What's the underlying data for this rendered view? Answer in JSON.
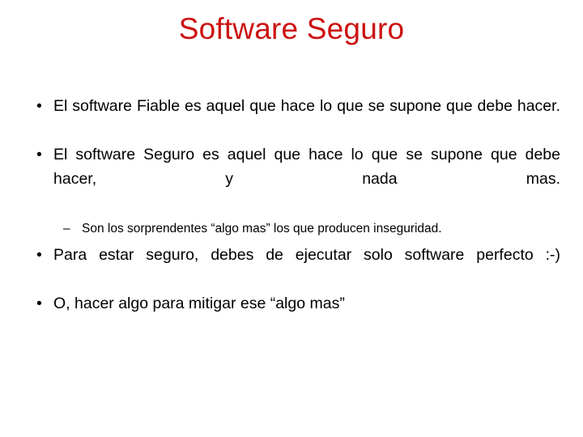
{
  "slide": {
    "title": "Software Seguro",
    "title_color": "#cc1111",
    "background_color": "#ffffff",
    "text_color": "#000000",
    "bullet_marker": "•",
    "dash_marker": "–",
    "content": [
      {
        "level": 1,
        "marker": "•",
        "text": "El software Fiable es aquel que hace lo que se supone que debe hacer."
      },
      {
        "level": 1,
        "marker": "•",
        "text": "El software Seguro es aquel que hace lo que se supone que debe hacer, y nada mas."
      },
      {
        "level": 2,
        "marker": "–",
        "text": "Son los sorprendentes “algo mas” los que producen inseguridad."
      },
      {
        "level": 1,
        "marker": "•",
        "text": "Para estar seguro, debes de ejecutar solo software perfecto :-)"
      },
      {
        "level": 1,
        "marker": "•",
        "text": "O, hacer algo para mitigar ese “algo mas”"
      }
    ]
  }
}
